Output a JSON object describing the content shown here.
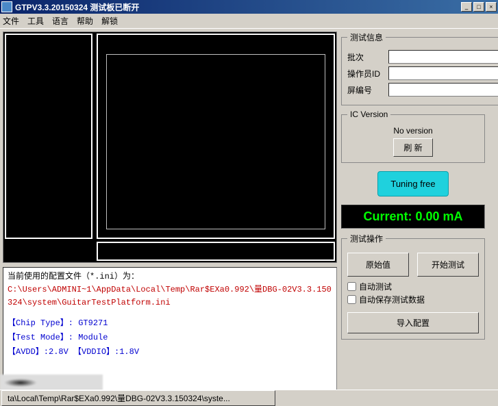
{
  "title": "GTPV3.3.20150324    测试板已断开",
  "menu": {
    "file": "文件",
    "tool": "工具",
    "lang": "语言",
    "help": "帮助",
    "unlock": "解锁"
  },
  "testinfo": {
    "legend": "测试信息",
    "batch_label": "批次",
    "operator_label": "操作员ID",
    "screen_label": "屏编号",
    "batch_value": "",
    "operator_value": "",
    "screen_value": ""
  },
  "icversion": {
    "legend": "IC Version",
    "status": "No version",
    "refresh": "刷 新"
  },
  "tuning": "Tuning free",
  "current": "Current: 0.00 mA",
  "testop": {
    "legend": "测试操作",
    "raw_btn": "原始值",
    "start_btn": "开始测试",
    "auto_test": "自动测试",
    "auto_save": "自动保存测试数据",
    "import_btn": "导入配置"
  },
  "info": {
    "cfg_label": "当前使用的配置文件（*.ini）为：",
    "cfg_path": "C:\\Users\\ADMINI~1\\AppData\\Local\\Temp\\Rar$EXa0.992\\量DBG-02V3.3.150324\\system\\GuitarTestPlatform.ini",
    "chip": "【Chip Type】: GT9271",
    "mode": "【Test Mode】: Module",
    "volt": "【AVDD】:2.8V  【VDDIO】:1.8V"
  },
  "taskbar": "ta\\Local\\Temp\\Rar$EXa0.992\\量DBG-02V3.3.150324\\syste..."
}
